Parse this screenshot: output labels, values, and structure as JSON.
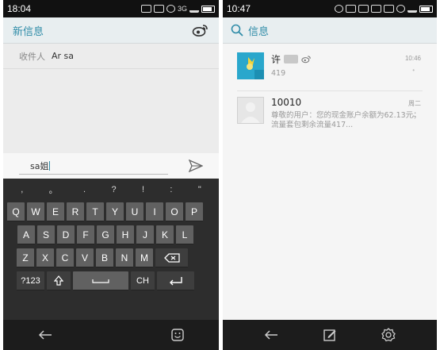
{
  "left": {
    "status": {
      "time": "18:04",
      "network": "3G"
    },
    "header": {
      "title": "新信息"
    },
    "recipient": {
      "label": "收件人",
      "value": "Ar sa"
    },
    "compose": {
      "text": "sa姐"
    },
    "keyboard": {
      "symbols": [
        ",",
        "。",
        ".",
        "?",
        "!",
        ":",
        "\""
      ],
      "row1": [
        "Q",
        "W",
        "E",
        "R",
        "T",
        "Y",
        "U",
        "I",
        "O",
        "P"
      ],
      "row2": [
        "A",
        "S",
        "D",
        "F",
        "G",
        "H",
        "J",
        "K",
        "L"
      ],
      "row3": [
        "Z",
        "X",
        "C",
        "V",
        "B",
        "N",
        "M"
      ],
      "sym_label": "?123",
      "lang_label": "CH"
    }
  },
  "right": {
    "status": {
      "time": "10:47"
    },
    "search": {
      "placeholder": "信息"
    },
    "conversations": [
      {
        "name": "许",
        "preview": "419",
        "time": "10:46"
      },
      {
        "name": "10010",
        "preview": "尊敬的用户：您的现金账户余额为62.13元；流量套包剩余流量417...",
        "time": "周二"
      }
    ]
  },
  "colors": {
    "accent": "#2f8ca8",
    "keyboard_bg": "#2d2d2d",
    "key": "#616161",
    "nav_bg": "#1c1c1c"
  },
  "icons": [
    "weibo-icon",
    "send-icon",
    "shift-icon",
    "delete-icon",
    "space-icon",
    "enter-icon",
    "back-icon",
    "emoji-icon",
    "search-icon",
    "compose-icon",
    "settings-icon"
  ]
}
